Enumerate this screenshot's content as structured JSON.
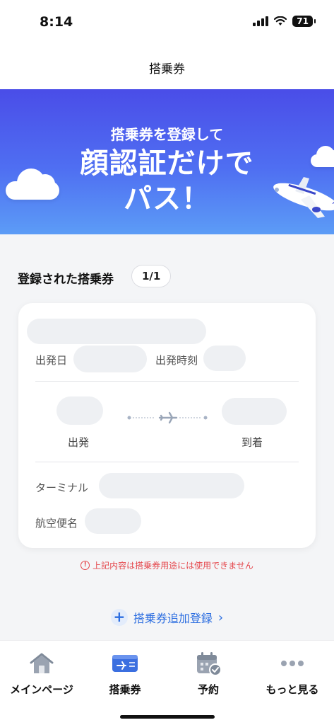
{
  "status_bar": {
    "time": "8:14",
    "battery": "71"
  },
  "header": {
    "title": "搭乗券"
  },
  "banner": {
    "subtitle": "搭乗券を登録して",
    "headline_line1": "顔認証だけで",
    "headline_line2": "パス！"
  },
  "registered": {
    "section_title": "登録された搭乗券",
    "count": "1/1",
    "card": {
      "departure_date_label": "出発日",
      "departure_time_label": "出発時刻",
      "origin_label": "出発",
      "destination_label": "到着",
      "terminal_label": "ターミナル",
      "flight_label": "航空便名"
    }
  },
  "warning": {
    "text": "上記内容は搭乗券用途には使用できません",
    "icon": "!"
  },
  "add_button": {
    "label": "搭乗券追加登録",
    "icon": "+",
    "chevron": "›"
  },
  "tabbar": {
    "items": [
      {
        "label": "メインページ",
        "icon": "home-icon"
      },
      {
        "label": "搭乗券",
        "icon": "boarding-pass-icon"
      },
      {
        "label": "予約",
        "icon": "calendar-check-icon"
      },
      {
        "label": "もっと見る",
        "icon": "more-icon"
      }
    ]
  },
  "colors": {
    "accent": "#2b6de0",
    "banner_top": "#4a4de8",
    "banner_bottom": "#5c9cf6",
    "warning": "#e5484d"
  }
}
